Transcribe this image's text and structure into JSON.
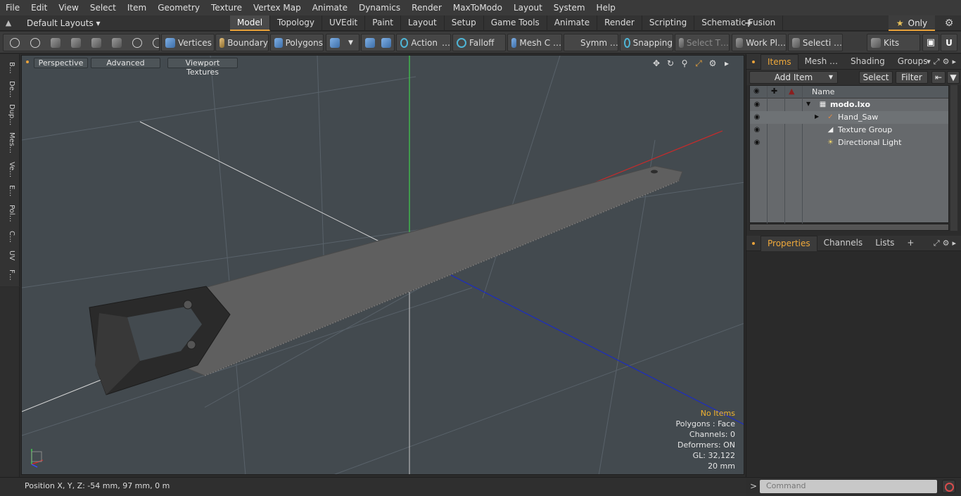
{
  "menu": [
    "File",
    "Edit",
    "View",
    "Select",
    "Item",
    "Geometry",
    "Texture",
    "Vertex Map",
    "Animate",
    "Dynamics",
    "Render",
    "MaxToModo",
    "Layout",
    "System",
    "Help"
  ],
  "layouts": {
    "label": "Default Layouts ▾",
    "tabs": [
      "Model",
      "Topology",
      "UVEdit",
      "Paint",
      "Layout",
      "Setup",
      "Game Tools",
      "Animate",
      "Render",
      "Scripting",
      "Schematic Fusion"
    ],
    "active_tab": "Model",
    "add_tab": "+",
    "only_label": "Only",
    "only_star": "★"
  },
  "toolbar": {
    "vertices": "Vertices",
    "boundary": "Boundary",
    "polygons": "Polygons",
    "action": "Action",
    "falloff": "Falloff",
    "mesh": "Mesh C …",
    "symmetry": "Symm …",
    "snapping": "Snapping",
    "select_t": "Select T…",
    "work_plane": "Work Pl…",
    "selection": "Selecti …",
    "kits": "Kits"
  },
  "left_tabs": [
    "B…",
    "De…",
    "Dup…",
    "Mes…",
    "Ve…",
    "E…",
    "Pol…",
    "C…",
    "UV",
    "F…"
  ],
  "viewport": {
    "view_mode": "Perspective",
    "shading": "Advanced",
    "textures": "Viewport Textures",
    "info": {
      "selection": "No Items",
      "polygons": "Polygons : Face",
      "channels": "Channels: 0",
      "deformers": "Deformers: ON",
      "gl": "GL: 32,122",
      "grid": "20 mm"
    }
  },
  "status": {
    "position": "Position X, Y, Z:   -54 mm, 97 mm, 0 m"
  },
  "items_panel": {
    "tabs": [
      "Items",
      "Mesh …",
      "Shading",
      "Groups"
    ],
    "active_tab": "Items",
    "add_item": "Add Item",
    "select": "Select",
    "filter": "Filter",
    "column_name": "Name",
    "tree": [
      {
        "label": "modo.lxo",
        "level": 0,
        "bold": true,
        "icon": "scene-icon"
      },
      {
        "label": "Hand_Saw",
        "level": 1,
        "bold": false,
        "icon": "mesh-icon"
      },
      {
        "label": "Texture Group",
        "level": 1,
        "bold": false,
        "icon": "texture-icon"
      },
      {
        "label": "Directional Light",
        "level": 1,
        "bold": false,
        "icon": "light-icon"
      }
    ]
  },
  "props_panel": {
    "tabs": [
      "Properties",
      "Channels",
      "Lists"
    ],
    "active_tab": "Properties",
    "add_tab": "+"
  },
  "command": {
    "placeholder": "Command",
    "prompt": ">"
  },
  "colors": {
    "accent": "#e8a23b",
    "x_axis": "#c92a2a",
    "y_axis": "#3ecf4a",
    "z_axis": "#1f2fb8",
    "viewport_bg": "#434a4f"
  }
}
